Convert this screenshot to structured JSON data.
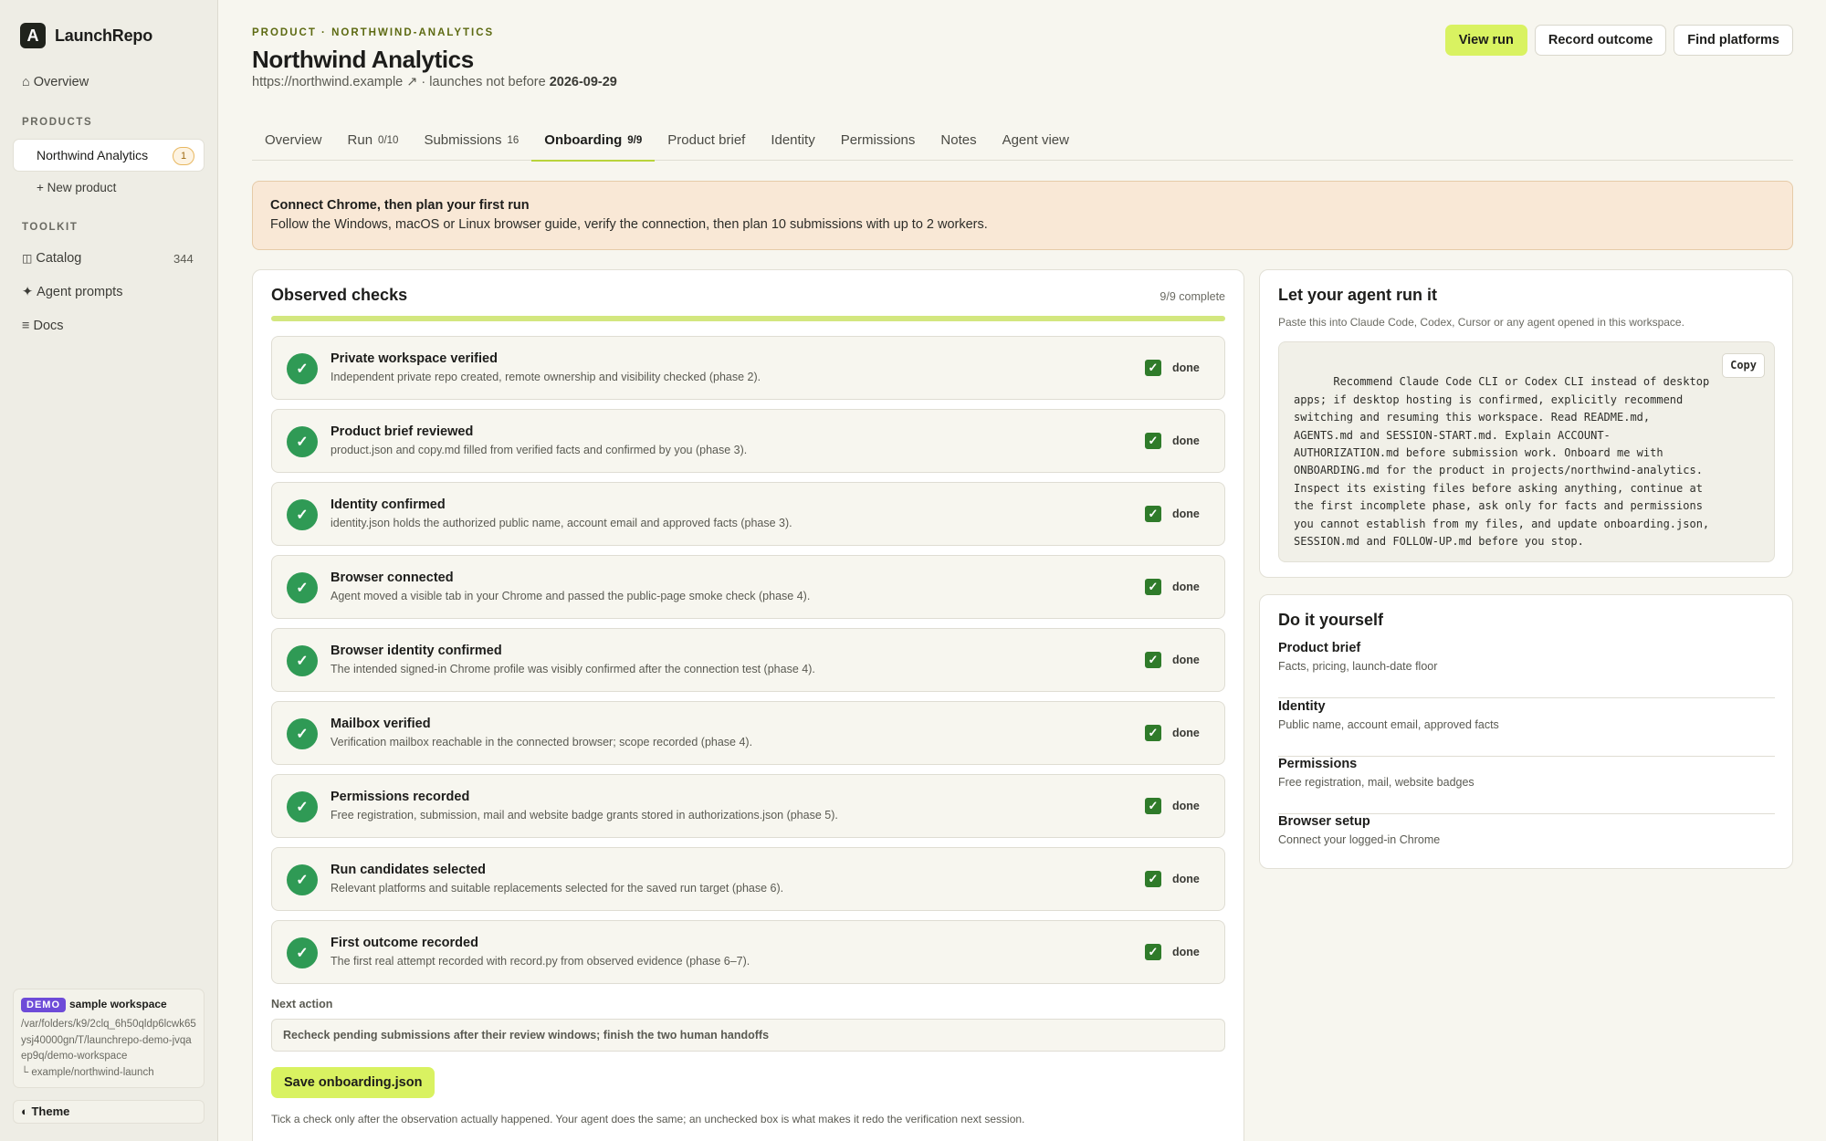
{
  "app": {
    "logo_letter": "A",
    "name": "LaunchRepo"
  },
  "sidebar": {
    "overview": {
      "icon": "⌂",
      "label": "Overview"
    },
    "products_heading": "PRODUCTS",
    "product": {
      "label": "Northwind Analytics",
      "badge": "1"
    },
    "new_product": "+ New product",
    "toolkit_heading": "TOOLKIT",
    "catalog": {
      "icon": "◫",
      "label": "Catalog",
      "count": "344"
    },
    "agent_prompts": {
      "icon": "✦",
      "label": "Agent prompts"
    },
    "docs": {
      "icon": "≡",
      "label": "Docs"
    },
    "demo": {
      "tag": "DEMO",
      "title": "sample workspace",
      "path": "/var/folders/k9/2clq_6h50qldp6lcwk65ysj40000gn/T/launchrepo-demo-jvqaep9q/demo-workspace",
      "subpath": "└ example/northwind-launch"
    },
    "theme": {
      "icon": "◐",
      "label": "Theme"
    }
  },
  "header": {
    "eyebrow": "PRODUCT · NORTHWIND-ANALYTICS",
    "title": "Northwind Analytics",
    "url": "https://northwind.example ↗",
    "launch_prefix": " · launches not before ",
    "launch_date": "2026-09-29",
    "buttons": {
      "view_run": "View run",
      "record_outcome": "Record outcome",
      "find_platforms": "Find platforms"
    }
  },
  "tabs": [
    {
      "label": "Overview",
      "count": ""
    },
    {
      "label": "Run",
      "count": "0/10"
    },
    {
      "label": "Submissions",
      "count": "16"
    },
    {
      "label": "Onboarding",
      "count": "9/9"
    },
    {
      "label": "Product brief",
      "count": ""
    },
    {
      "label": "Identity",
      "count": ""
    },
    {
      "label": "Permissions",
      "count": ""
    },
    {
      "label": "Notes",
      "count": ""
    },
    {
      "label": "Agent view",
      "count": ""
    }
  ],
  "banner": {
    "title": "Connect Chrome, then plan your first run",
    "text": "Follow the Windows, macOS or Linux browser guide, verify the connection, then plan 10 submissions with up to 2 workers."
  },
  "checks": {
    "title": "Observed checks",
    "complete": "9/9 complete",
    "progress": 1.0,
    "items": [
      {
        "title": "Private workspace verified",
        "desc": "Independent private repo created, remote ownership and visibility checked (phase 2).",
        "status": "done"
      },
      {
        "title": "Product brief reviewed",
        "desc": "product.json and copy.md filled from verified facts and confirmed by you (phase 3).",
        "status": "done"
      },
      {
        "title": "Identity confirmed",
        "desc": "identity.json holds the authorized public name, account email and approved facts (phase 3).",
        "status": "done"
      },
      {
        "title": "Browser connected",
        "desc": "Agent moved a visible tab in your Chrome and passed the public-page smoke check (phase 4).",
        "status": "done"
      },
      {
        "title": "Browser identity confirmed",
        "desc": "The intended signed-in Chrome profile was visibly confirmed after the connection test (phase 4).",
        "status": "done"
      },
      {
        "title": "Mailbox verified",
        "desc": "Verification mailbox reachable in the connected browser; scope recorded (phase 4).",
        "status": "done"
      },
      {
        "title": "Permissions recorded",
        "desc": "Free registration, submission, mail and website badge grants stored in authorizations.json (phase 5).",
        "status": "done"
      },
      {
        "title": "Run candidates selected",
        "desc": "Relevant platforms and suitable replacements selected for the saved run target (phase 6).",
        "status": "done"
      },
      {
        "title": "First outcome recorded",
        "desc": "The first real attempt recorded with record.py from observed evidence (phase 6–7).",
        "status": "done"
      }
    ],
    "next_action_label": "Next action",
    "next_action_value": "Recheck pending submissions after their review windows; finish the two human handoffs",
    "save_label": "Save onboarding.json",
    "footnote": "Tick a check only after the observation actually happened. Your agent does the same; an unchecked box is what makes it redo the verification next session."
  },
  "agent": {
    "title": "Let your agent run it",
    "subtitle": "Paste this into Claude Code, Codex, Cursor or any agent opened in this workspace.",
    "copy_label": "Copy",
    "prompt": "Recommend Claude Code CLI or Codex CLI instead of desktop apps; if desktop hosting is confirmed, explicitly recommend switching and resuming this workspace. Read README.md, AGENTS.md and SESSION-START.md. Explain ACCOUNT-AUTHORIZATION.md before submission work. Onboard me with ONBOARDING.md for the product in projects/northwind-analytics. Inspect its existing files before asking anything, continue at the first incomplete phase, ask only for facts and permissions you cannot establish from my files, and update onboarding.json, SESSION.md and FOLLOW-UP.md before you stop."
  },
  "diy": {
    "title": "Do it yourself",
    "items": [
      {
        "title": "Product brief",
        "desc": "Facts, pricing, launch-date floor"
      },
      {
        "title": "Identity",
        "desc": "Public name, account email, approved facts"
      },
      {
        "title": "Permissions",
        "desc": "Free registration, mail, website badges"
      },
      {
        "title": "Browser setup",
        "desc": "Connect your logged-in Chrome"
      }
    ]
  },
  "colors": {
    "accent": "#d9f261",
    "success": "#2f9a55",
    "demo": "#6e4bd8",
    "banner": "#f9e8d6"
  }
}
